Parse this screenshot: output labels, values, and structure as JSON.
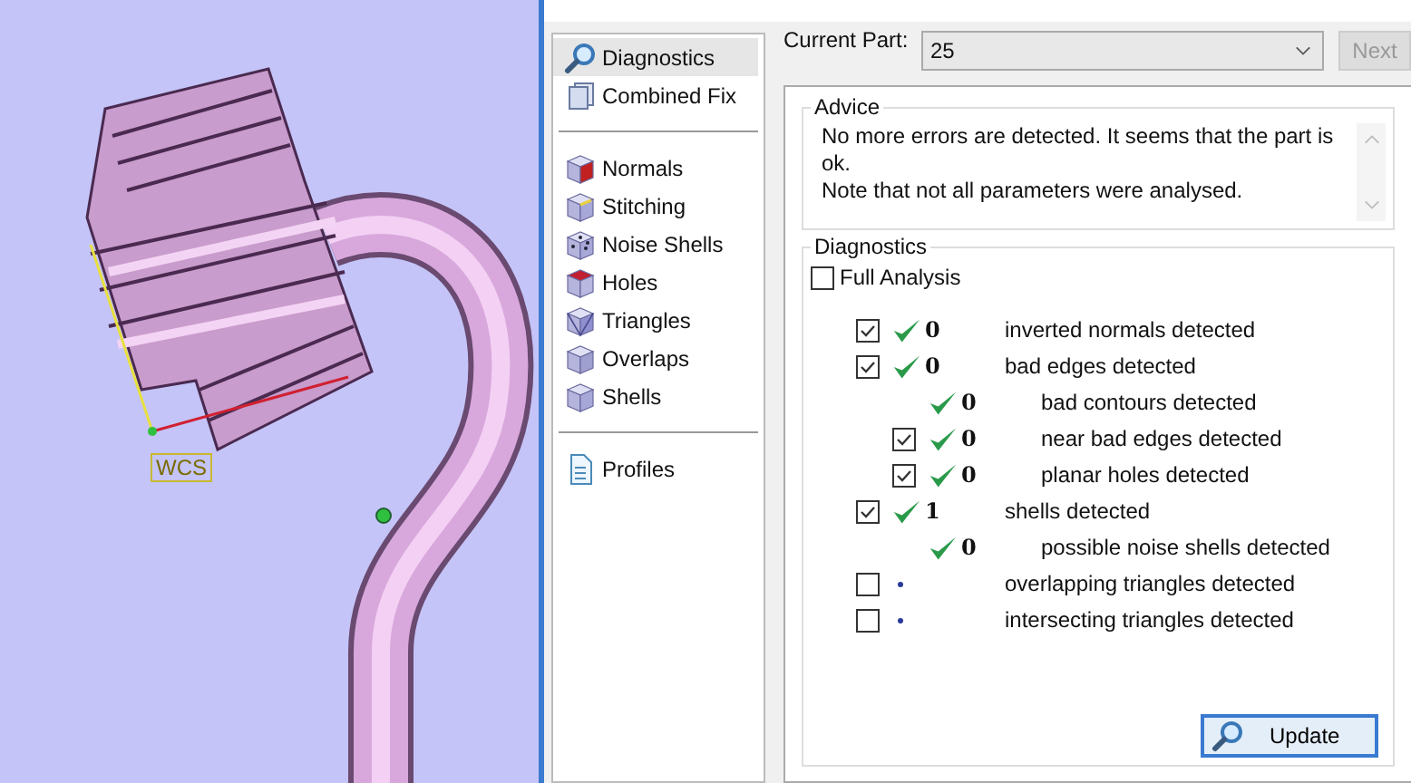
{
  "viewport": {
    "axis_label": "WCS"
  },
  "sidebar": {
    "groups": [
      [
        {
          "label": "Diagnostics",
          "selected": true
        },
        {
          "label": "Combined Fix",
          "selected": false
        }
      ],
      [
        {
          "label": "Normals",
          "selected": false
        },
        {
          "label": "Stitching",
          "selected": false
        },
        {
          "label": "Noise Shells",
          "selected": false
        },
        {
          "label": "Holes",
          "selected": false
        },
        {
          "label": "Triangles",
          "selected": false
        },
        {
          "label": "Overlaps",
          "selected": false
        },
        {
          "label": "Shells",
          "selected": false
        }
      ],
      [
        {
          "label": "Profiles",
          "selected": false
        }
      ]
    ]
  },
  "current_part": {
    "label": "Current Part:",
    "value": "25",
    "next_button": {
      "label": "Next",
      "disabled": true
    }
  },
  "advice": {
    "title": "Advice",
    "text": "No more errors are detected. It seems that the part is ok.\nNote that not all parameters were analysed."
  },
  "diagnostics": {
    "title": "Diagnostics",
    "full_analysis": {
      "label": "Full Analysis",
      "checked": false
    },
    "rows": [
      {
        "kind": "boxed",
        "checked": true,
        "count": "0",
        "label": "inverted normals detected"
      },
      {
        "kind": "boxed",
        "checked": true,
        "count": "0",
        "label": "bad edges detected",
        "children": [
          {
            "kind": "plain",
            "count": "0",
            "label": "bad contours detected"
          },
          {
            "kind": "boxed",
            "checked": true,
            "count": "0",
            "label": "near bad edges detected"
          },
          {
            "kind": "boxed",
            "checked": true,
            "count": "0",
            "label": "planar holes detected"
          }
        ]
      },
      {
        "kind": "boxed",
        "checked": true,
        "count": "1",
        "label": "shells detected",
        "children": [
          {
            "kind": "plain",
            "count": "0",
            "label": "possible noise shells detected"
          }
        ]
      },
      {
        "kind": "pending",
        "checked": false,
        "label": "overlapping triangles detected"
      },
      {
        "kind": "pending",
        "checked": false,
        "label": "intersecting triangles detected"
      }
    ],
    "update_button": "Update"
  }
}
